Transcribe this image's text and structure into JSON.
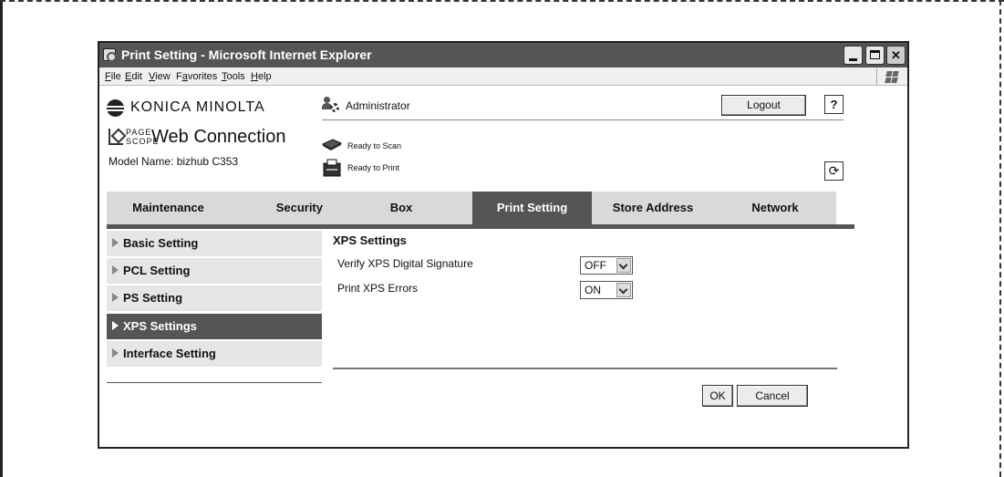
{
  "window": {
    "title": "Print Setting - Microsoft Internet Explorer",
    "minimize_glyph": "_",
    "close_glyph": "✕"
  },
  "menubar": {
    "items": [
      {
        "label_first": "F",
        "label_rest": "ile"
      },
      {
        "label_first": "E",
        "label_rest": "dit"
      },
      {
        "label_first": "V",
        "label_rest": "iew"
      },
      {
        "label_pre": "F",
        "label_first": "a",
        "label_rest": "vorites"
      },
      {
        "label_first": "T",
        "label_rest": "ools"
      },
      {
        "label_first": "H",
        "label_rest": "elp"
      }
    ]
  },
  "brand": {
    "logo_text": "KONICA MINOLTA",
    "page_scope_line1": "PAGE",
    "page_scope_line2": "SCOPE",
    "product": "Web Connection",
    "model_name": "Model Name: bizhub C353"
  },
  "header": {
    "user_label": "Administrator",
    "logout_label": "Logout",
    "help_label": "?",
    "scan_status": "Ready to Scan",
    "print_status": "Ready to Print",
    "refresh_glyph": "⟳"
  },
  "tabs": [
    {
      "label": "Maintenance",
      "active": false
    },
    {
      "label": "Security",
      "active": false
    },
    {
      "label": "Box",
      "active": false
    },
    {
      "label": "Print Setting",
      "active": true
    },
    {
      "label": "Store Address",
      "active": false
    },
    {
      "label": "Network",
      "active": false
    }
  ],
  "sidebar": {
    "items": [
      {
        "label": "Basic Setting",
        "active": false
      },
      {
        "label": "PCL Setting",
        "active": false
      },
      {
        "label": "PS Setting",
        "active": false
      },
      {
        "label": "XPS Settings",
        "active": true
      },
      {
        "label": "Interface Setting",
        "active": false
      }
    ]
  },
  "main": {
    "section_title": "XPS Settings",
    "settings": [
      {
        "label": "Verify XPS Digital Signature",
        "value": "OFF"
      },
      {
        "label": "Print XPS Errors",
        "value": "ON"
      }
    ],
    "ok_label": "OK",
    "cancel_label": "Cancel"
  },
  "colors": {
    "active_tab": "#555555",
    "inactive_tab": "#d9d9d9",
    "titlebar": "#555555"
  }
}
